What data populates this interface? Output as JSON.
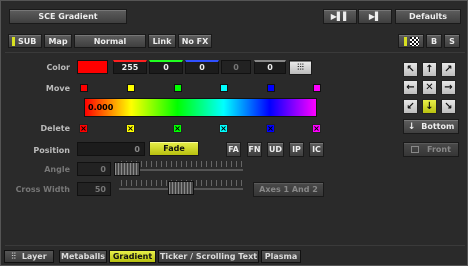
{
  "header": {
    "title": "SCE Gradient",
    "defaults_label": "Defaults"
  },
  "toolbar": {
    "sub_label": "SUB",
    "map_label": "Map",
    "blend_mode": "Normal",
    "link_label": "Link",
    "nofx_label": "No FX",
    "b_label": "B",
    "s_label": "S"
  },
  "color": {
    "label": "Color",
    "swatch": "#ff0000",
    "r": "255",
    "g": "0",
    "b": "0",
    "w": "0",
    "a": "0"
  },
  "gradient": {
    "move_label": "Move",
    "delete_label": "Delete",
    "value": "0.000",
    "marker_colors": [
      "#ff0000",
      "#ffff00",
      "#00ff00",
      "#00ffff",
      "#0000ff",
      "#ff00ff"
    ]
  },
  "position": {
    "label": "Position",
    "value": "0",
    "fade_label": "Fade",
    "buttons": [
      "FA",
      "FN",
      "UD",
      "IP",
      "IC"
    ]
  },
  "angle": {
    "label": "Angle",
    "value": "0"
  },
  "cross_width": {
    "label": "Cross Width",
    "value": "50",
    "axes_label": "Axes 1 And 2"
  },
  "direction": {
    "arrows": [
      "↖",
      "↑",
      "↗",
      "←",
      "✕",
      "→",
      "↙",
      "↓",
      "↘"
    ],
    "active_index": 7,
    "bottom_label": "Bottom",
    "front_label": "Front"
  },
  "tabs": {
    "layer_label": "Layer",
    "items": [
      "Metaballs",
      "Gradient",
      "Ticker / Scrolling Text",
      "Plasma"
    ],
    "active": "Gradient"
  }
}
